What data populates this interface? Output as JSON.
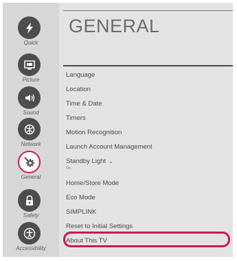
{
  "sidebar": {
    "items": [
      {
        "label": "Quick",
        "icon": "lightning-icon"
      },
      {
        "label": "Picture",
        "icon": "picture-icon"
      },
      {
        "label": "Sound",
        "icon": "speaker-icon"
      },
      {
        "label": "Network",
        "icon": "globe-icon"
      },
      {
        "label": "General",
        "icon": "gear-icon",
        "active": true
      },
      {
        "label": "Safety",
        "icon": "lock-icon"
      },
      {
        "label": "Accessibility",
        "icon": "accessibility-icon"
      }
    ]
  },
  "main": {
    "title": "GENERAL",
    "menu": [
      {
        "label": "Language"
      },
      {
        "label": "Location"
      },
      {
        "label": "Time & Date"
      },
      {
        "label": "Timers"
      },
      {
        "label": "Motion Recognition"
      },
      {
        "label": "Launch Account Management"
      },
      {
        "label": "Standby Light",
        "value": "On"
      },
      {
        "label": "Home/Store Mode"
      },
      {
        "label": "Eco Mode"
      },
      {
        "label": "SIMPLINK"
      },
      {
        "label": "Reset to Initial Settings"
      },
      {
        "label": "About This TV",
        "highlighted": true
      }
    ]
  },
  "colors": {
    "accent": "#c8175a",
    "icon_bg": "#4d4d4d",
    "screen_bg": "#e3e3e3",
    "sidebar_bg": "#d7d7d7"
  }
}
